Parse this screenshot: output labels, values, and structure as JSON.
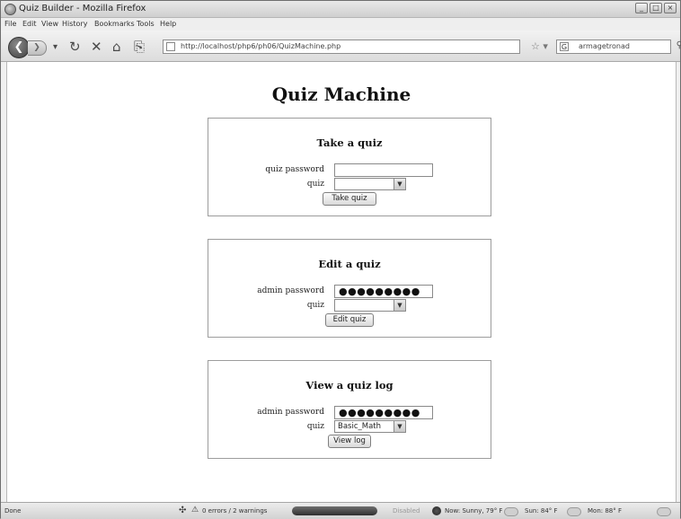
{
  "window": {
    "title": "Quiz Builder - Mozilla Firefox"
  },
  "menu": [
    "File",
    "Edit",
    "View",
    "History",
    "Bookmarks",
    "Tools",
    "Help"
  ],
  "nav": {
    "url": "http://localhost/php6/ph06/QuizMachine.php",
    "search_text": "armagetronad",
    "search_engine_glyph": "G"
  },
  "page": {
    "title": "Quiz Machine"
  },
  "take_quiz": {
    "heading": "Take a quiz",
    "password_label": "quiz password",
    "password_value": "",
    "quiz_label": "quiz",
    "quiz_value": "",
    "button": "Take quiz"
  },
  "edit_quiz": {
    "heading": "Edit a quiz",
    "password_label": "admin password",
    "password_value": "●●●●●●●●●",
    "quiz_label": "quiz",
    "quiz_value": "",
    "button": "Edit quiz"
  },
  "view_log": {
    "heading": "View a quiz log",
    "password_label": "admin password",
    "password_value": "●●●●●●●●●",
    "quiz_label": "quiz",
    "quiz_value": "Basic_Math",
    "button": "View log"
  },
  "status": {
    "left": "Done",
    "errors": "0 errors / 2 warnings",
    "disabled": "Disabled",
    "weather_now": "Now: Sunny, 79° F",
    "weather_sun": "Sun: 84° F",
    "weather_mon": "Mon: 88° F"
  }
}
